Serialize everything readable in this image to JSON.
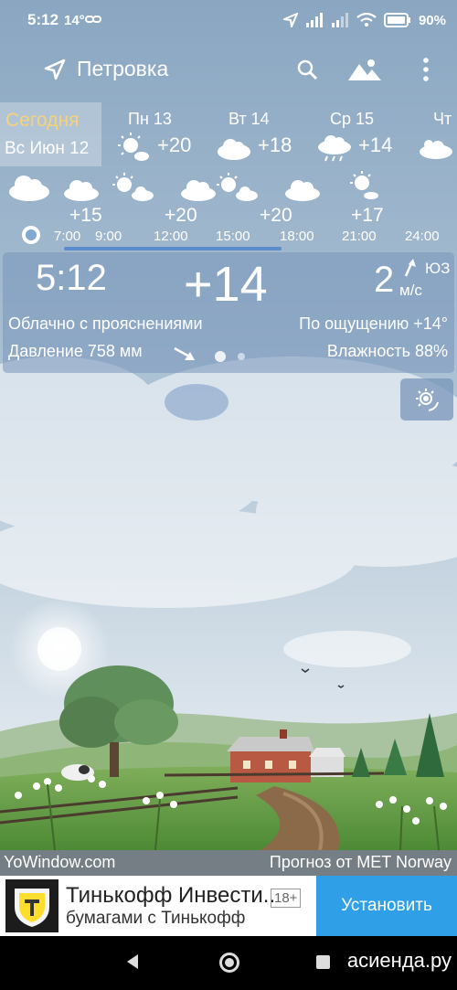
{
  "status_bar": {
    "time": "5:12",
    "temp": "14°",
    "battery": "90%"
  },
  "toolbar": {
    "location": "Петровка"
  },
  "forecast_days": {
    "today_label": "Сегодня",
    "today_date": "Вс Июн 12",
    "days": [
      {
        "name": "Пн 13",
        "temp": "+20",
        "icon": "sun-cloud-icon"
      },
      {
        "name": "Вт 14",
        "temp": "+18",
        "icon": "cloud-icon"
      },
      {
        "name": "Ср 15",
        "temp": "+14",
        "icon": "rain-cloud-icon"
      },
      {
        "name": "Чт",
        "temp": "",
        "icon": "cloud-icon"
      }
    ]
  },
  "hourly": {
    "temps": [
      "+15",
      "+20",
      "+20",
      "+17"
    ],
    "times": [
      "7:00",
      "9:00",
      "12:00",
      "15:00",
      "18:00",
      "21:00",
      "24:00"
    ]
  },
  "current": {
    "time": "5:12",
    "temp": "+14",
    "wind_speed": "2",
    "wind_dir": "ЮЗ",
    "wind_unit": "м/с",
    "description": "Облачно с прояснениями",
    "feels_like": "По ощущению +14°",
    "pressure": "Давление 758 мм",
    "humidity": "Влажность 88%"
  },
  "footer": {
    "left": "YoWindow.com",
    "right": "Прогноз от MET Norway"
  },
  "ad": {
    "title": "Тинькофф Инвести..",
    "age": "18+",
    "subtitle": "бумагами с Тинькофф",
    "button": "Установить"
  },
  "watermark": "асиенда.ру"
}
